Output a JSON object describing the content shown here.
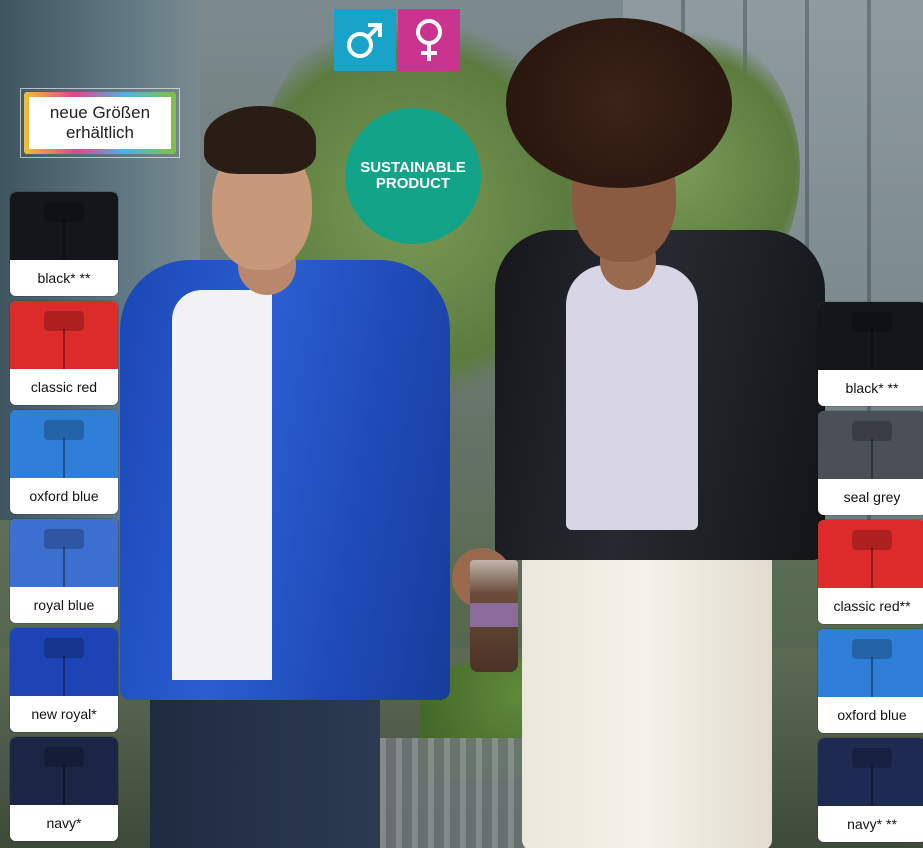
{
  "badges": {
    "male_symbol": "♂",
    "female_symbol": "♀",
    "male_color": "#1aa3c9",
    "female_color": "#c8348e"
  },
  "sizes_badge": {
    "line1": "neue Größen",
    "line2": "erhältlich"
  },
  "sustainable": {
    "line1": "SUSTAINABLE",
    "line2": "PRODUCT",
    "color": "#13a389"
  },
  "left_swatches": [
    {
      "label": "black* **",
      "color": "#14161a"
    },
    {
      "label": "classic red",
      "color": "#dd2a2a"
    },
    {
      "label": "oxford blue",
      "color": "#2f7fd8"
    },
    {
      "label": "royal blue",
      "color": "#3c6fd0"
    },
    {
      "label": "new royal*",
      "color": "#1d44b4"
    },
    {
      "label": "navy*",
      "color": "#1b2646"
    }
  ],
  "right_swatches": [
    {
      "label": "black* **",
      "color": "#14161a"
    },
    {
      "label": "seal grey",
      "color": "#4b4f56"
    },
    {
      "label": "classic red**",
      "color": "#dd2a2a"
    },
    {
      "label": "oxford blue",
      "color": "#2f7fd8"
    },
    {
      "label": "navy* **",
      "color": "#1e2a52"
    }
  ]
}
